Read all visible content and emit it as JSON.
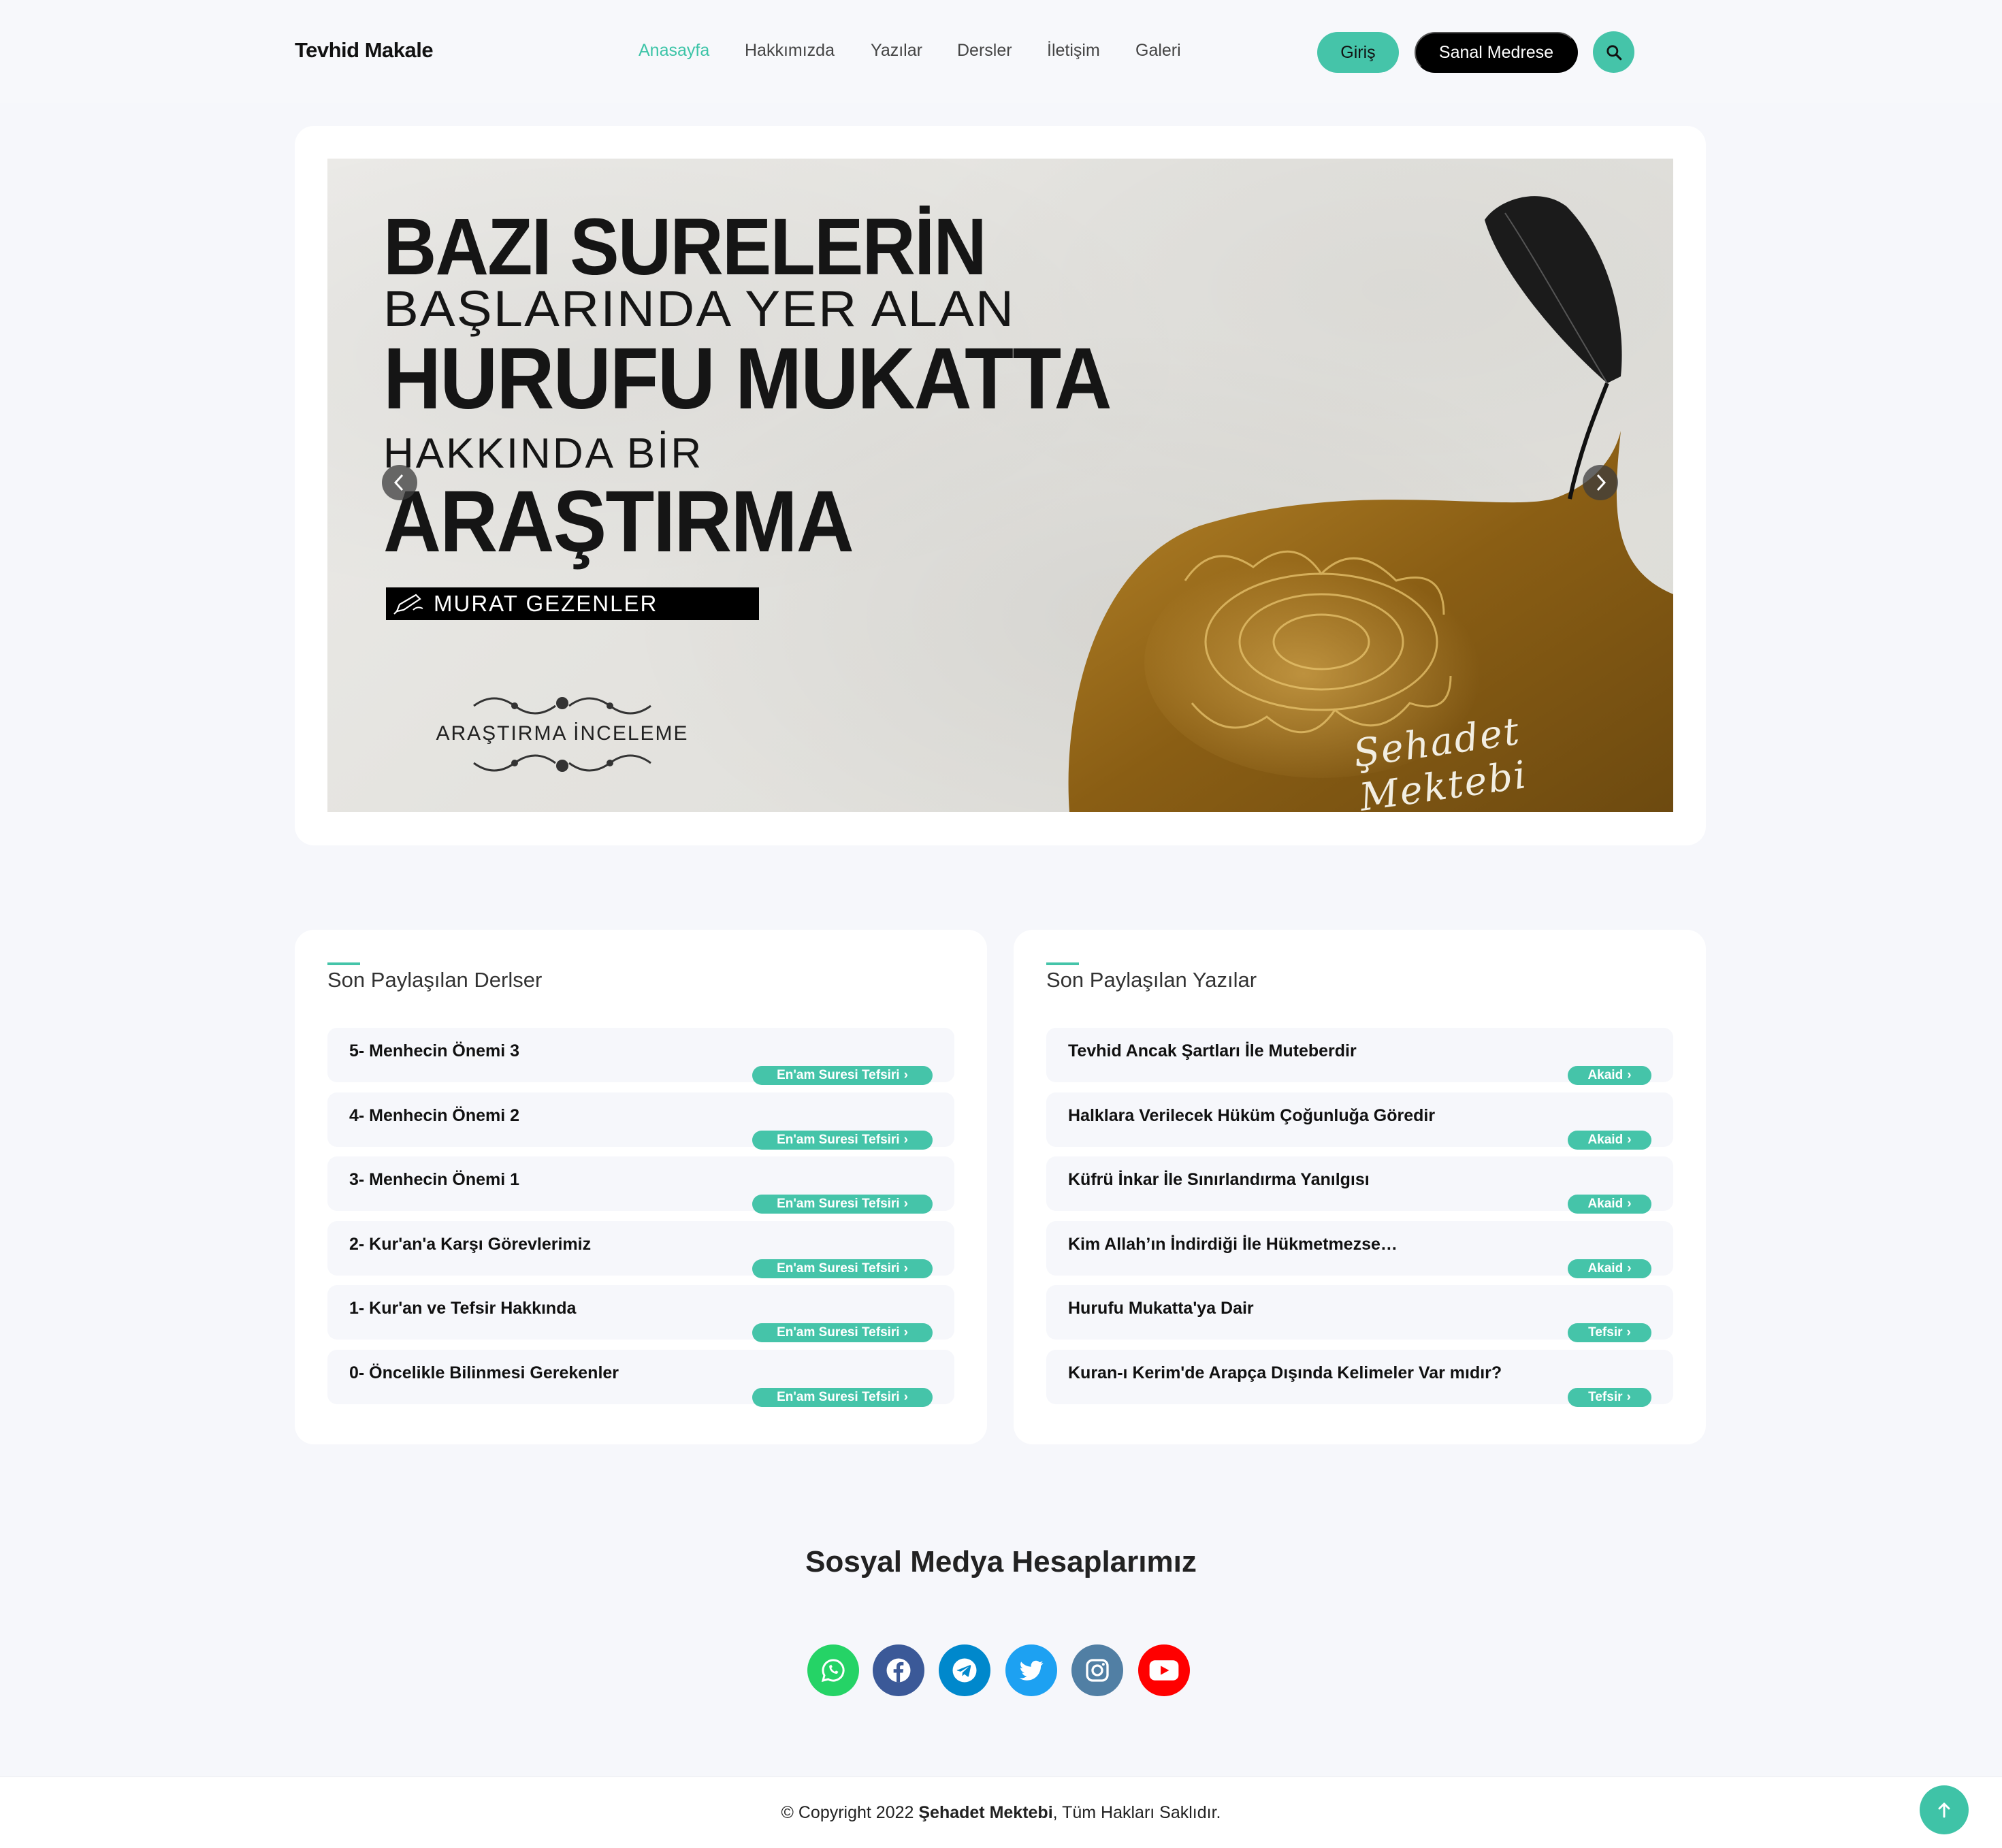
{
  "header": {
    "brand": "Tevhid Makale",
    "nav": [
      "Anasayfa",
      "Hakkımızda",
      "Yazılar",
      "Dersler",
      "İletişim",
      "Galeri"
    ],
    "login_label": "Giriş",
    "medrese_label": "Sanal Medrese",
    "search_icon": "search-icon"
  },
  "slider": {
    "line1": "BAZI SURELERİN",
    "line2": "BAŞLARINDA YER ALAN",
    "line3": "HURUFU MUKATTA",
    "line4": "HAKKINDA BİR",
    "line5": "ARAŞTIRMA",
    "author": "MURAT GEZENLER",
    "category": "ARAŞTIRMA İNCELEME",
    "signature": "Şehadet Mektebi"
  },
  "lessons": {
    "title": "Son Paylaşılan Derlser",
    "items": [
      {
        "title": "5- Menhecin Önemi 3",
        "tag": "En'am Suresi Tefsiri"
      },
      {
        "title": "4- Menhecin Önemi 2",
        "tag": "En'am Suresi Tefsiri"
      },
      {
        "title": "3- Menhecin Önemi 1",
        "tag": "En'am Suresi Tefsiri"
      },
      {
        "title": "2- Kur'an'a Karşı Görevlerimiz",
        "tag": "En'am Suresi Tefsiri"
      },
      {
        "title": "1- Kur'an ve Tefsir Hakkında",
        "tag": "En'am Suresi Tefsiri"
      },
      {
        "title": "0- Öncelikle Bilinmesi Gerekenler",
        "tag": "En'am Suresi Tefsiri"
      }
    ]
  },
  "articles": {
    "title": "Son Paylaşılan Yazılar",
    "items": [
      {
        "title": "Tevhid Ancak Şartları İle Muteberdir",
        "tag": "Akaid"
      },
      {
        "title": "Halklara Verilecek Hüküm Çoğunluğa Göredir",
        "tag": "Akaid"
      },
      {
        "title": "Küfrü İnkar İle Sınırlandırma Yanılgısı",
        "tag": "Akaid"
      },
      {
        "title": "Kim Allah’ın İndirdiği İle Hükmetmezse…",
        "tag": "Akaid"
      },
      {
        "title": "Hurufu Mukatta'ya Dair",
        "tag": "Tefsir"
      },
      {
        "title": "Kuran-ı Kerim'de Arapça Dışında Kelimeler Var mıdır?",
        "tag": "Tefsir"
      }
    ]
  },
  "social": {
    "title": "Sosyal Medya Hesaplarımız",
    "icons": [
      {
        "name": "whatsapp-icon",
        "color": "#25d366"
      },
      {
        "name": "facebook-icon",
        "color": "#3b5998"
      },
      {
        "name": "telegram-icon",
        "color": "#0088cc"
      },
      {
        "name": "twitter-icon",
        "color": "#1da1f2"
      },
      {
        "name": "instagram-icon",
        "color": "#517fa4"
      },
      {
        "name": "youtube-icon",
        "color": "#ff0000"
      }
    ]
  },
  "footer": {
    "prefix": "© Copyright 2022 ",
    "org": "Şehadet Mektebi",
    "suffix": ", Tüm Hakları Saklıdır."
  },
  "colors": {
    "accent": "#45c4a9",
    "dark": "#000000",
    "background": "#f6f7fb"
  }
}
